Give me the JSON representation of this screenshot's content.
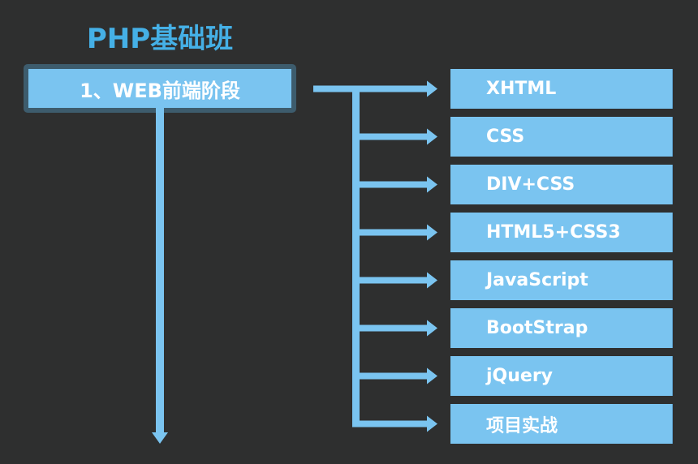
{
  "title": "PHP基础班",
  "stage": {
    "label": "1、WEB前端阶段"
  },
  "topics": [
    {
      "label": "XHTML"
    },
    {
      "label": "CSS"
    },
    {
      "label": "DIV+CSS"
    },
    {
      "label": "HTML5+CSS3"
    },
    {
      "label": "JavaScript"
    },
    {
      "label": "BootStrap"
    },
    {
      "label": "jQuery"
    },
    {
      "label": "项目实战"
    }
  ],
  "colors": {
    "background": "#2e2f2f",
    "title": "#45b0e6",
    "box": "#7ac4f0",
    "frame": "#3d5c6d",
    "arrow": "#7ac4f0",
    "text": "#ffffff"
  }
}
